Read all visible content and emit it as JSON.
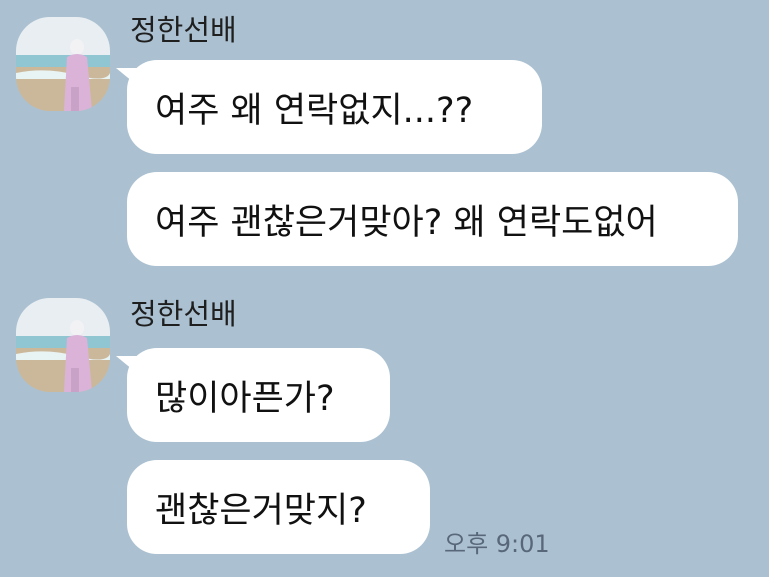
{
  "colors": {
    "background": "#abc1d1",
    "bubble": "#ffffff",
    "timestamp": "#58677a"
  },
  "groups": [
    {
      "sender": "정한선배",
      "avatar_icon": "profile-photo-icon",
      "messages": [
        {
          "text": "여주 왜 연락없지...??"
        },
        {
          "text": "여주 괜찮은거맞아? 왜 연락도없어"
        }
      ]
    },
    {
      "sender": "정한선배",
      "avatar_icon": "profile-photo-icon",
      "messages": [
        {
          "text": "많이아픈가?"
        },
        {
          "text": "괜찮은거맞지?"
        }
      ],
      "time": "오후 9:01"
    }
  ]
}
